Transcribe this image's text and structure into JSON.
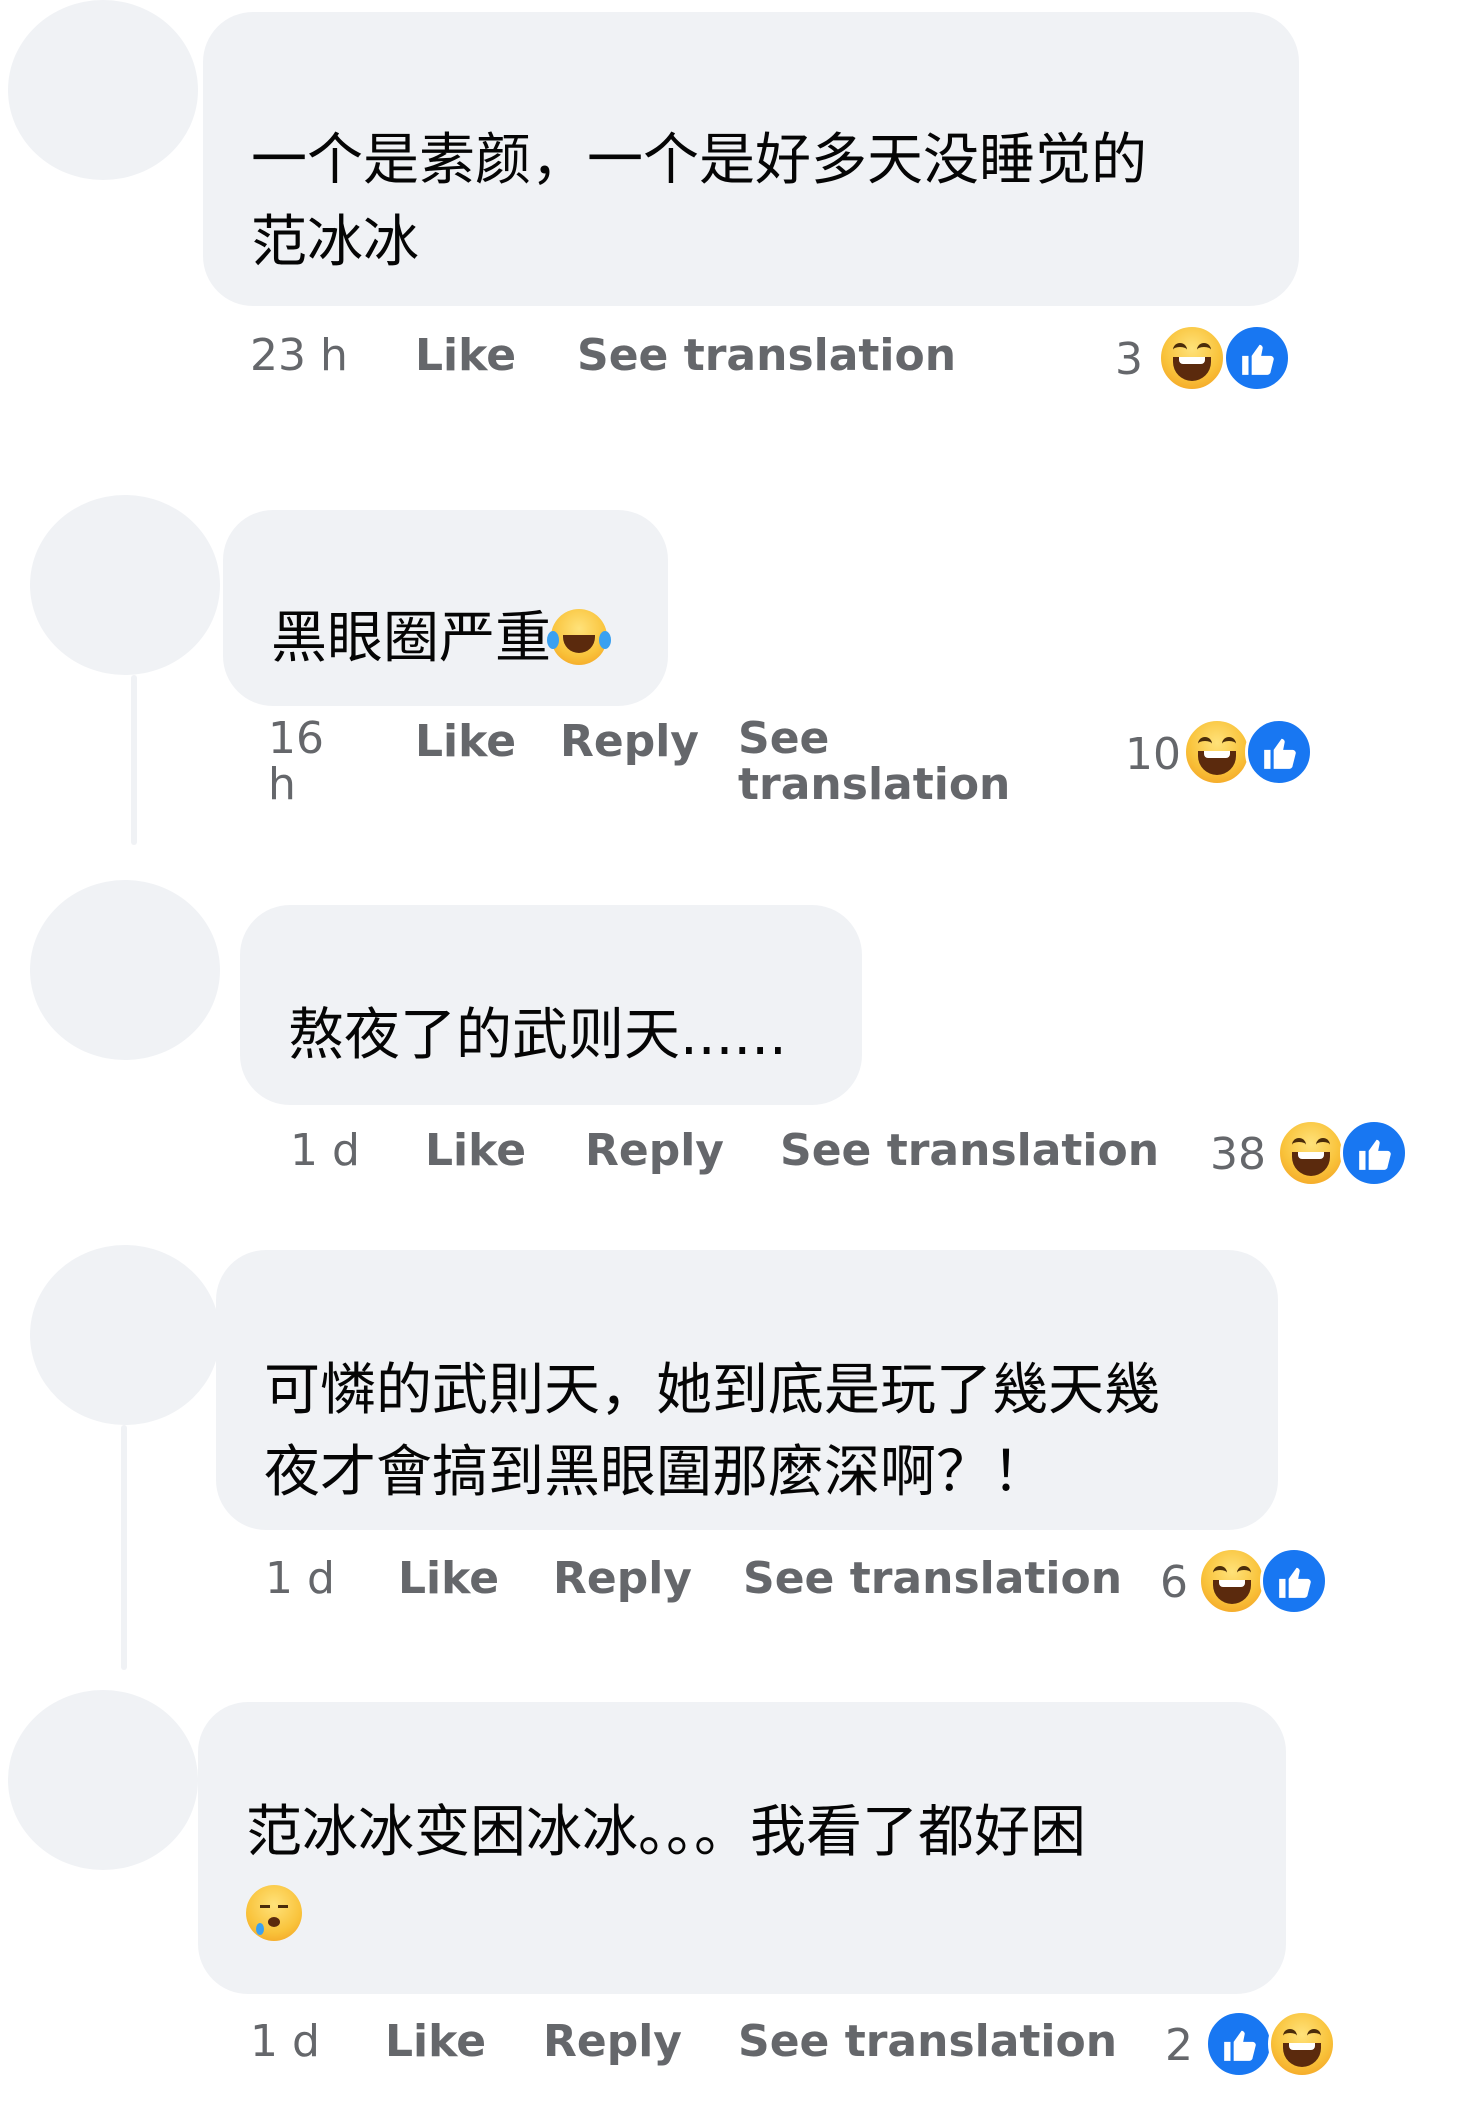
{
  "comments": [
    {
      "text_lines": [
        "一个是素颜，一个是好多天没睡觉的",
        "范冰冰"
      ],
      "time": "23 h",
      "actions": {
        "like": "Like",
        "reply": "",
        "translate": "See translation"
      },
      "reaction_count": "3",
      "reactions": [
        "haha-icon",
        "like-icon"
      ]
    },
    {
      "text": "黑眼圈严重",
      "inline_emoji": "face-with-tears-of-joy-icon",
      "time": "16 h",
      "actions": {
        "like": "Like",
        "reply": "Reply",
        "translate": "See translation"
      },
      "reaction_count": "10",
      "reactions": [
        "haha-icon",
        "like-icon"
      ]
    },
    {
      "text": "熬夜了的武则天......",
      "time": "1 d",
      "actions": {
        "like": "Like",
        "reply": "Reply",
        "translate": "See translation"
      },
      "reaction_count": "38",
      "reactions": [
        "haha-icon",
        "like-icon"
      ]
    },
    {
      "text_lines": [
        "可憐的武則天，她到底是玩了幾天幾",
        "夜才會搞到黑眼圍那麼深啊？！"
      ],
      "time": "1 d",
      "actions": {
        "like": "Like",
        "reply": "Reply",
        "translate": "See translation"
      },
      "reaction_count": "6",
      "reactions": [
        "haha-icon",
        "like-icon"
      ]
    },
    {
      "text": "范冰冰变困冰冰。。。我看了都好困",
      "inline_emoji": "sleepy-face-icon",
      "time": "1 d",
      "actions": {
        "like": "Like",
        "reply": "Reply",
        "translate": "See translation"
      },
      "reaction_count": "2",
      "reactions": [
        "like-icon",
        "haha-icon"
      ]
    }
  ],
  "colors": {
    "bubble": "#f0f2f5",
    "meta_text": "#65676b",
    "like_blue": "#1877f2"
  }
}
